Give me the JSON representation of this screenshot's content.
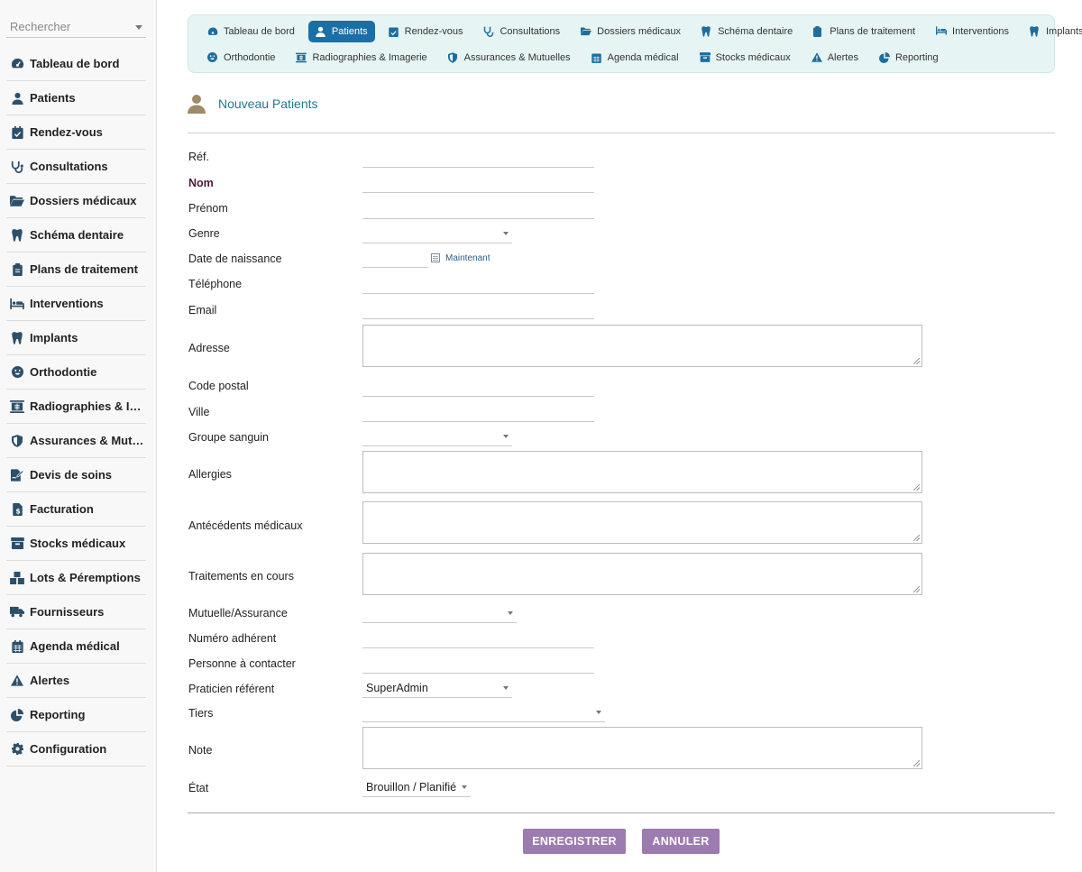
{
  "sidebar": {
    "search_placeholder": "Rechercher",
    "items": [
      {
        "label": "Tableau de bord"
      },
      {
        "label": "Patients"
      },
      {
        "label": "Rendez-vous"
      },
      {
        "label": "Consultations"
      },
      {
        "label": "Dossiers médicaux"
      },
      {
        "label": "Schéma dentaire"
      },
      {
        "label": "Plans de traitement"
      },
      {
        "label": "Interventions"
      },
      {
        "label": "Implants"
      },
      {
        "label": "Orthodontie"
      },
      {
        "label": "Radiographies & Ima…"
      },
      {
        "label": "Assurances & Mutue…"
      },
      {
        "label": "Devis de soins"
      },
      {
        "label": "Facturation"
      },
      {
        "label": "Stocks médicaux"
      },
      {
        "label": "Lots & Péremptions"
      },
      {
        "label": "Fournisseurs"
      },
      {
        "label": "Agenda médical"
      },
      {
        "label": "Alertes"
      },
      {
        "label": "Reporting"
      },
      {
        "label": "Configuration"
      }
    ]
  },
  "topnav": {
    "row1": [
      {
        "label": "Tableau de bord"
      },
      {
        "label": "Patients"
      },
      {
        "label": "Rendez-vous"
      },
      {
        "label": "Consultations"
      },
      {
        "label": "Dossiers médicaux"
      },
      {
        "label": "Schéma dentaire"
      },
      {
        "label": "Plans de traitement"
      },
      {
        "label": "Interventions"
      },
      {
        "label": "Implants"
      }
    ],
    "row2": [
      {
        "label": "Orthodontie"
      },
      {
        "label": "Radiographies & Imagerie"
      },
      {
        "label": "Assurances & Mutuelles"
      },
      {
        "label": "Agenda médical"
      },
      {
        "label": "Stocks médicaux"
      },
      {
        "label": "Alertes"
      },
      {
        "label": "Reporting"
      }
    ],
    "active": "Patients",
    "active_color": "#1b6fa7"
  },
  "page": {
    "title": "Nouveau Patients"
  },
  "form": {
    "ref_label": "Réf.",
    "nom_label": "Nom",
    "prenom_label": "Prénom",
    "genre_label": "Genre",
    "dob_label": "Date de naissance",
    "now_link": "Maintenant",
    "phone_label": "Téléphone",
    "email_label": "Email",
    "address_label": "Adresse",
    "postal_label": "Code postal",
    "city_label": "Ville",
    "blood_label": "Groupe sanguin",
    "allergies_label": "Allergies",
    "history_label": "Antécédents médicaux",
    "treatments_label": "Traitements en cours",
    "insurance_label": "Mutuelle/Assurance",
    "member_label": "Numéro adhérent",
    "contact_label": "Personne à contacter",
    "practitioner_label": "Praticien référent",
    "practitioner_value": "SuperAdmin",
    "tiers_label": "Tiers",
    "note_label": "Note",
    "state_label": "État",
    "state_value": "Brouillon / Planifié"
  },
  "actions": {
    "save_label": "ENREGISTRER",
    "cancel_label": "ANNULER",
    "button_color": "#9c7bb0"
  }
}
